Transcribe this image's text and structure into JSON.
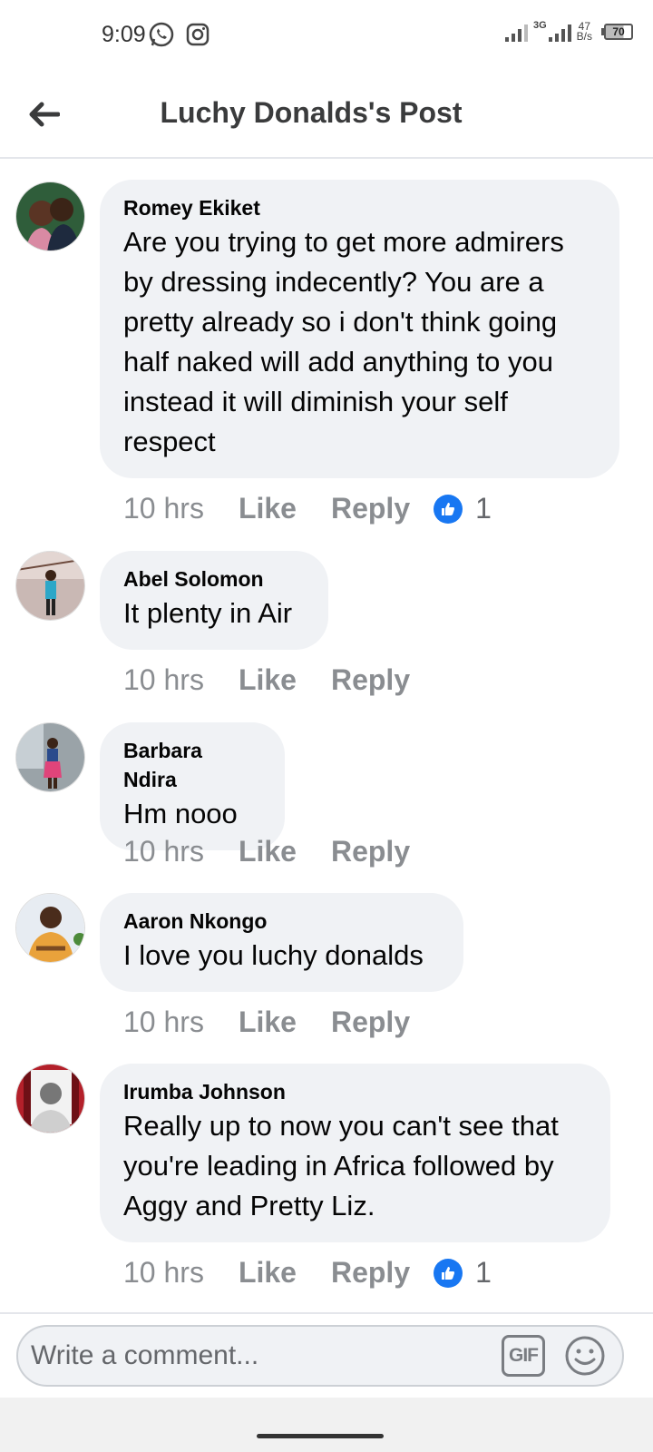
{
  "status_bar": {
    "time": "9:09",
    "network_type": "3G",
    "speed_value": "47",
    "speed_unit": "B/s",
    "battery": "70",
    "icons": [
      "whatsapp-icon",
      "instagram-icon",
      "signal-icon",
      "battery-icon"
    ]
  },
  "header": {
    "title": "Luchy Donalds's Post",
    "back_icon": "arrow-left-icon"
  },
  "comments": [
    {
      "author": "Romey Ekiket",
      "text": "Are you trying to get more admirers by dressing indecently? You are a pretty already so i don't think going half naked will add anything to you instead it will diminish your self respect",
      "time": "10 hrs",
      "like_label": "Like",
      "reply_label": "Reply",
      "reactions": "1"
    },
    {
      "author": "Abel Solomon",
      "text": "It plenty in Air",
      "time": "10 hrs",
      "like_label": "Like",
      "reply_label": "Reply"
    },
    {
      "author": "Barbara Ndira",
      "text": "Hm nooo",
      "time": "10 hrs",
      "like_label": "Like",
      "reply_label": "Reply"
    },
    {
      "author": "Aaron Nkongo",
      "text": "I love you luchy donalds",
      "time": "10 hrs",
      "like_label": "Like",
      "reply_label": "Reply"
    },
    {
      "author": "Irumba Johnson",
      "text": "Really up to now you can't see that you're leading in Africa followed by Aggy and Pretty Liz.",
      "time": "10 hrs",
      "like_label": "Like",
      "reply_label": "Reply",
      "reactions": "1"
    }
  ],
  "composer": {
    "placeholder": "Write a comment...",
    "gif_label": "GIF",
    "emoji_icon": "smiley-icon"
  },
  "colors": {
    "accent": "#1877f2",
    "bubble": "#f0f2f5",
    "muted_text": "#8a8d91"
  }
}
